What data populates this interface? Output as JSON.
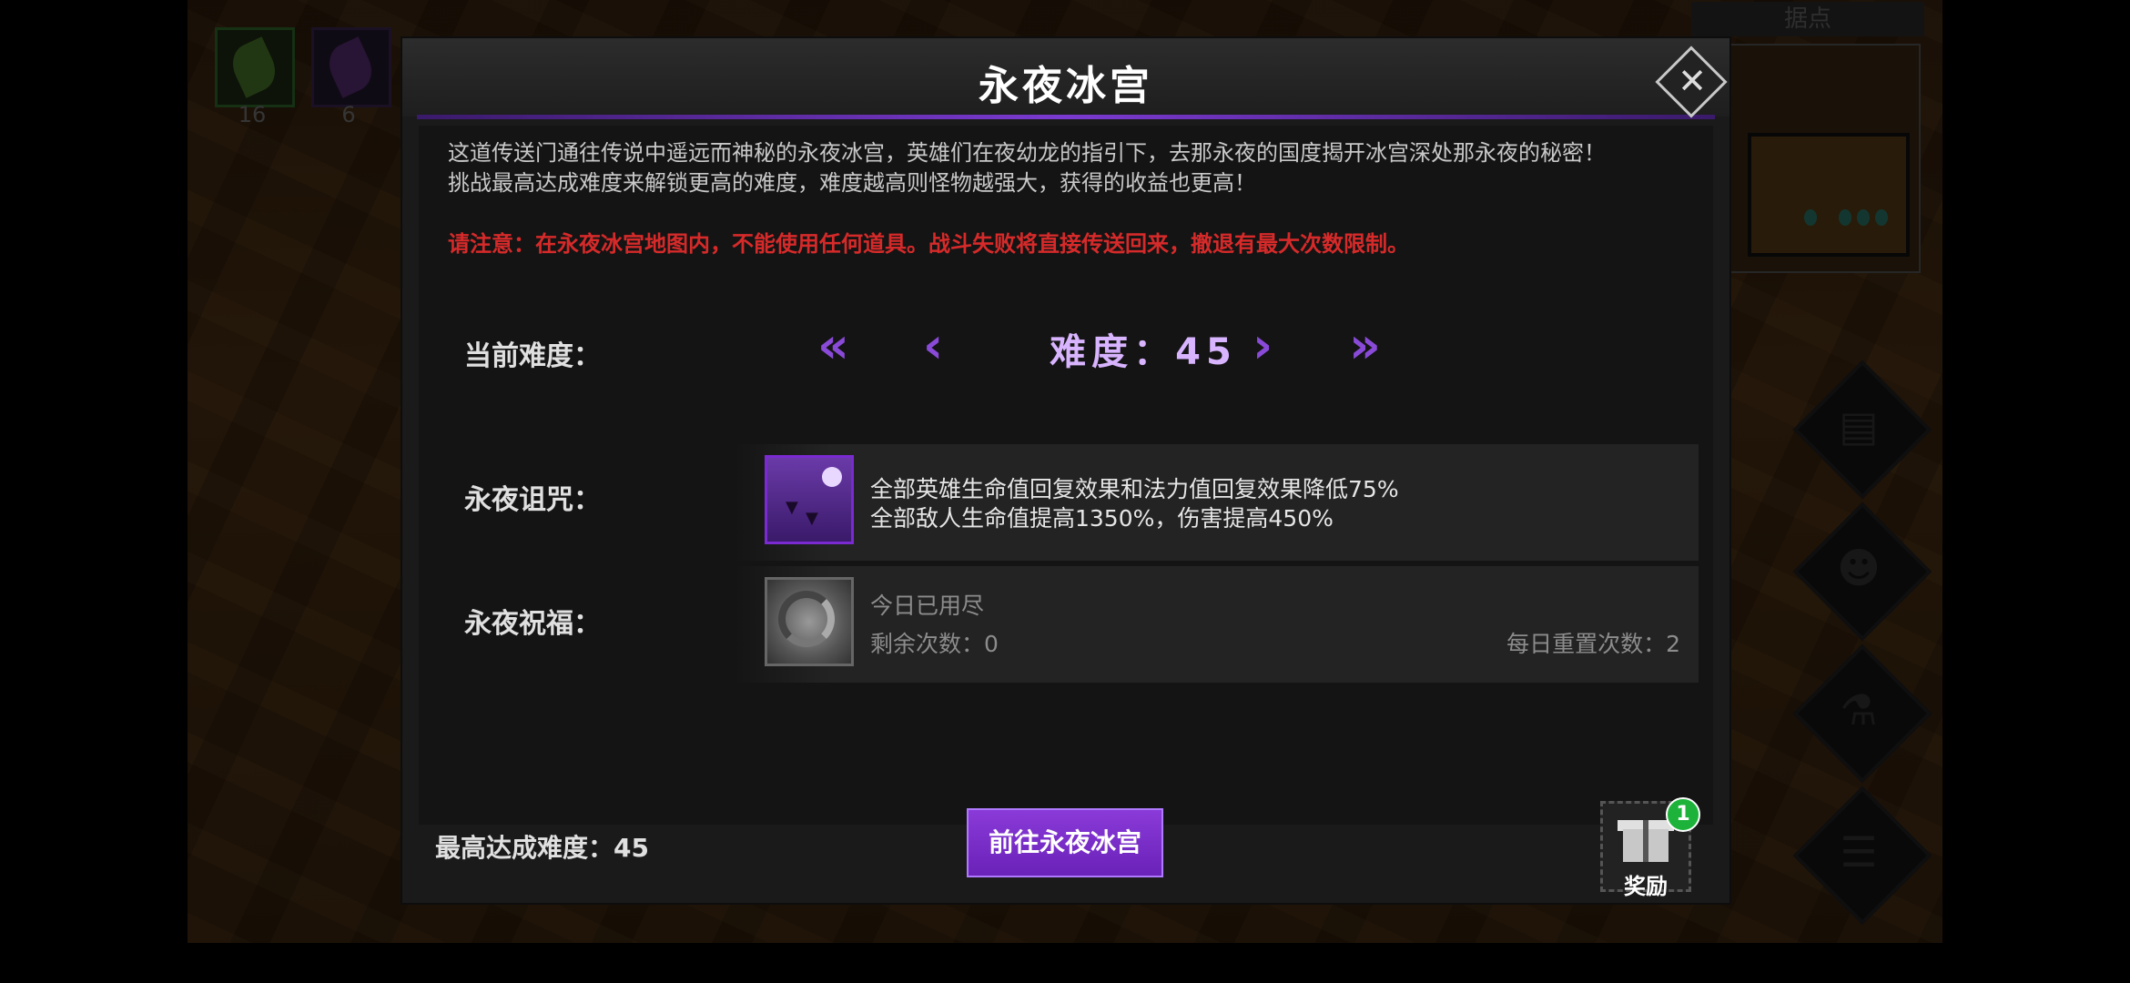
{
  "background": {
    "inventory": [
      {
        "count": "16"
      },
      {
        "count": "6"
      }
    ],
    "minimap_title": "据点"
  },
  "modal": {
    "title": "永夜冰宫",
    "description_line1": "这道传送门通往传说中遥远而神秘的永夜冰宫，英雄们在夜幼龙的指引下，去那永夜的国度揭开冰宫深处那永夜的秘密！",
    "description_line2": "挑战最高达成难度来解锁更高的难度，难度越高则怪物越强大，获得的收益也更高！",
    "warning": "请注意：在永夜冰宫地图内，不能使用任何道具。战斗失败将直接传送回来，撤退有最大次数限制。",
    "difficulty": {
      "label": "当前难度：",
      "value_text": "难度：45",
      "first": "«",
      "prev": "‹",
      "next": "›",
      "last": "»"
    },
    "curse": {
      "label": "永夜诅咒：",
      "line1": "全部英雄生命值回复效果和法力值回复效果降低75%",
      "line2": "全部敌人生命值提高1350%，伤害提高450%"
    },
    "blessing": {
      "label": "永夜祝福：",
      "status": "今日已用尽",
      "remaining": "剩余次数：0",
      "daily_reset": "每日重置次数：2"
    },
    "footer": {
      "max_difficulty": "最高达成难度：45",
      "go_button": "前往永夜冰宫",
      "reward_label": "奖励",
      "reward_badge": "1"
    }
  },
  "colors": {
    "accent_purple": "#8a3ad8",
    "warning_red": "#d62a2a",
    "badge_green": "#1db33a"
  }
}
